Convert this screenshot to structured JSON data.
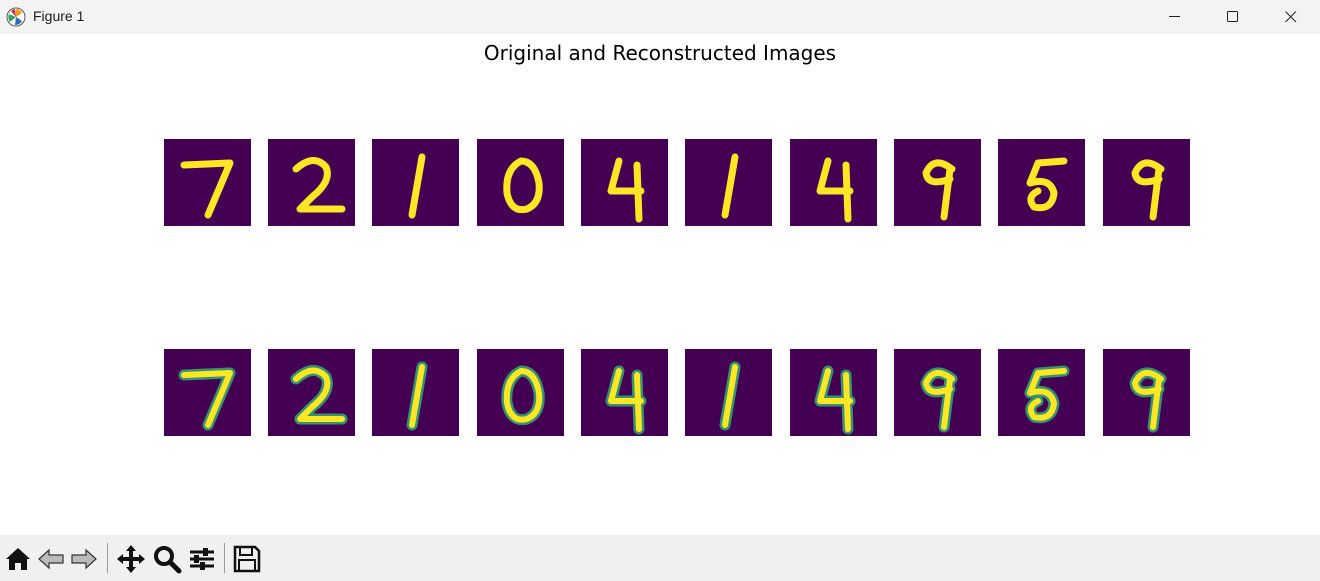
{
  "window": {
    "title": "Figure 1",
    "controls": [
      "minimize-icon",
      "maximize-icon",
      "close-icon"
    ]
  },
  "figure": {
    "suptitle": "Original and Reconstructed Images",
    "colormap": "viridis",
    "colors": {
      "background": "#440154",
      "stroke": "#fde725",
      "mid": "#35b779"
    },
    "rows": [
      {
        "row": "original",
        "digits": [
          "7",
          "2",
          "1",
          "0",
          "4",
          "1",
          "4",
          "9",
          "5",
          "9"
        ]
      },
      {
        "row": "reconstructed",
        "digits": [
          "7",
          "2",
          "1",
          "0",
          "4",
          "1",
          "4",
          "9",
          "5",
          "9"
        ]
      }
    ]
  },
  "toolbar": {
    "buttons": [
      {
        "icon": "home-icon"
      },
      {
        "icon": "back-arrow-icon"
      },
      {
        "icon": "forward-arrow-icon"
      },
      {
        "icon": "pan-move-icon"
      },
      {
        "icon": "zoom-icon"
      },
      {
        "icon": "configure-subplots-icon"
      },
      {
        "icon": "save-icon"
      }
    ]
  }
}
